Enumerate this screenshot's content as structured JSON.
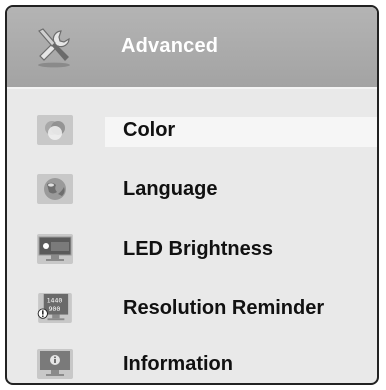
{
  "menu": {
    "title": "Advanced",
    "title_icon": "tools-icon",
    "items": [
      {
        "label": "Color",
        "icon": "color-circles-icon",
        "selected": true
      },
      {
        "label": "Language",
        "icon": "globe-icon",
        "selected": false
      },
      {
        "label": "LED Brightness",
        "icon": "monitor-brightness-icon",
        "selected": false
      },
      {
        "label": "Resolution Reminder",
        "icon": "resolution-monitor-icon",
        "icon_text_top": "1440",
        "icon_text_bottom": "900",
        "selected": false
      },
      {
        "label": "Information",
        "icon": "info-monitor-icon",
        "selected": false
      }
    ]
  },
  "colors": {
    "header_bg": "#a9a9a9",
    "body_bg": "#e9e9e9",
    "selection_bg": "#f6f6f6",
    "title_text": "#ffffff",
    "item_text": "#111111"
  }
}
